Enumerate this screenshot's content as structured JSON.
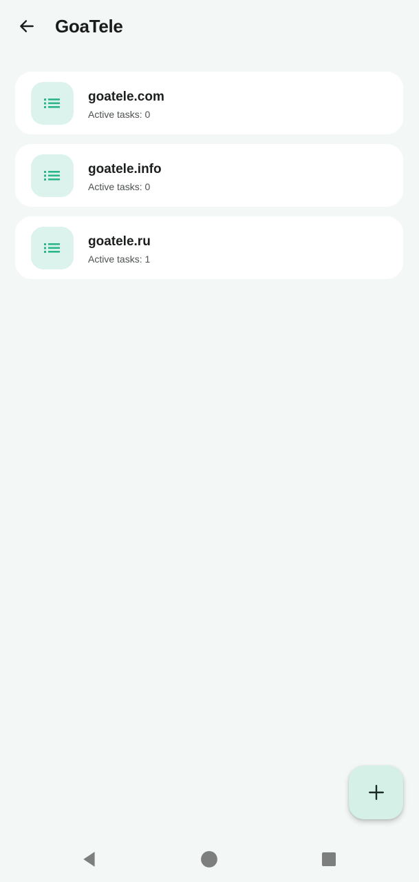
{
  "header": {
    "title": "GoaTele",
    "back_icon": "arrow-back-icon"
  },
  "items": [
    {
      "title": "goatele.com",
      "subtitle": "Active tasks: 0",
      "icon": "list-icon"
    },
    {
      "title": "goatele.info",
      "subtitle": "Active tasks: 0",
      "icon": "list-icon"
    },
    {
      "title": "goatele.ru",
      "subtitle": "Active tasks: 1",
      "icon": "list-icon"
    }
  ],
  "fab": {
    "icon": "plus-icon"
  },
  "navigation": {
    "back": "nav-back-icon",
    "home": "nav-home-icon",
    "recents": "nav-recents-icon"
  },
  "colors": {
    "background": "#f3f7f6",
    "card": "#ffffff",
    "icon_bg": "#dcf2ec",
    "accent": "#2bb58a",
    "fab_bg": "#d5f0e6",
    "text_primary": "#1d1f1f",
    "text_secondary": "#4b5150"
  }
}
